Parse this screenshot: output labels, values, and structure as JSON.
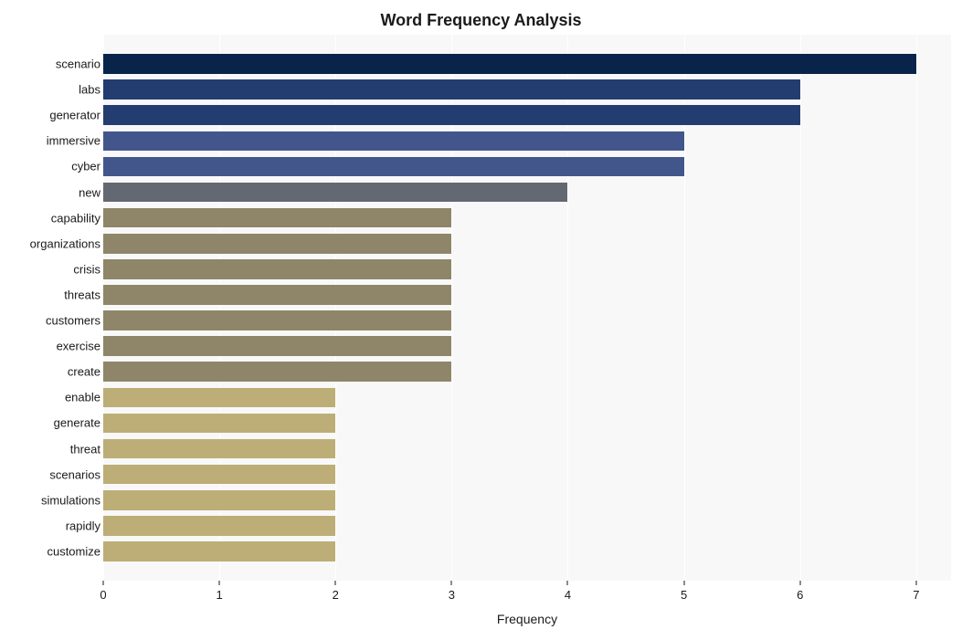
{
  "chart_data": {
    "type": "bar",
    "orientation": "horizontal",
    "title": "Word Frequency Analysis",
    "xlabel": "Frequency",
    "ylabel": "",
    "xlim": [
      0,
      7.3
    ],
    "x_ticks": [
      0,
      1,
      2,
      3,
      4,
      5,
      6,
      7
    ],
    "categories": [
      "scenario",
      "labs",
      "generator",
      "immersive",
      "cyber",
      "new",
      "capability",
      "organizations",
      "crisis",
      "threats",
      "customers",
      "exercise",
      "create",
      "enable",
      "generate",
      "threat",
      "scenarios",
      "simulations",
      "rapidly",
      "customize"
    ],
    "values": [
      7,
      6,
      6,
      5,
      5,
      4,
      3,
      3,
      3,
      3,
      3,
      3,
      3,
      2,
      2,
      2,
      2,
      2,
      2,
      2
    ],
    "colors": [
      "#08244a",
      "#243d70",
      "#243d70",
      "#42568b",
      "#42568b",
      "#636872",
      "#8f8669",
      "#8f8669",
      "#8f8669",
      "#8f8669",
      "#8f8669",
      "#8f8669",
      "#8f8669",
      "#bcae76",
      "#bcae76",
      "#bcae76",
      "#bcae76",
      "#bcae76",
      "#bcae76",
      "#bcae76"
    ]
  }
}
